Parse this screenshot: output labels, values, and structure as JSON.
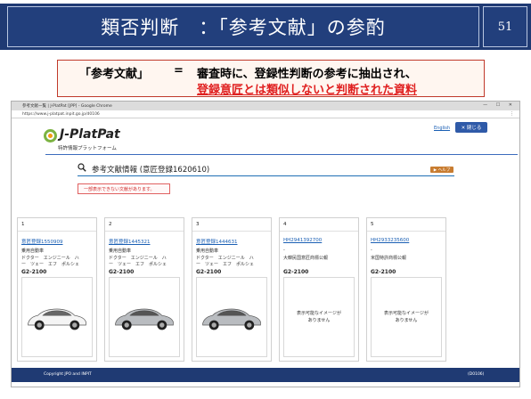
{
  "slide": {
    "title": "類否判断　：「参考文献」の参酌",
    "page_number": "51"
  },
  "definition": {
    "term": "「参考文献」",
    "equals": "=",
    "line1": "審査時に、登録性判断の参考に抽出され、",
    "line2": "登録意匠とは類似しないと判断された資料"
  },
  "browser": {
    "window_title": "参考文献一覧 | J-PlatPat [JPP] - Google Chrome",
    "url": "https://www.j-platpat.inpit.go.jp/d0106",
    "window_controls": "— ☐ ✕",
    "menu_icon": "⋮"
  },
  "site": {
    "logo_text": "J-PlatPat",
    "logo_subtitle": "特許情報プラットフォーム",
    "english_link": "English",
    "close_button": "✕ 閉じる",
    "section_title": "参考文献情報 (意匠登録1620610)",
    "help_button": "▶ ヘルプ",
    "warning": "一部表示できない文献があります。",
    "footer_copyright": "Copyright JPO and INPIT",
    "footer_code": "(D0106)"
  },
  "cards": [
    {
      "num": "1",
      "link": "意匠登録1550909",
      "line_a": "乗用自動車",
      "line_b": "ドクター　エンジニール　ハ",
      "line_c": "ー　ツェー　エフ　ポルシェ",
      "code": "G2-2100",
      "image": "car-white",
      "no_image_text": ""
    },
    {
      "num": "2",
      "link": "意匠登録1445321",
      "line_a": "乗用自動車",
      "line_b": "ドクター　エンジニール　ハ",
      "line_c": "ー　ツェー　エフ　ポルシェ",
      "code": "G2-2100",
      "image": "car-silver",
      "no_image_text": ""
    },
    {
      "num": "3",
      "link": "意匠登録1444631",
      "line_a": "乗用自動車",
      "line_b": "ドクター　エンジニール　ハ",
      "line_c": "ー　ツェー　エフ　ポルシェ",
      "code": "G2-2100",
      "image": "car-silver",
      "no_image_text": ""
    },
    {
      "num": "4",
      "link": "HH2941392700",
      "line_a": "-",
      "line_b": "大韓民国意匠商標公報",
      "line_c": "",
      "code": "G2-2100",
      "image": "none",
      "no_image_text": "表示可能なイメージが\nありません"
    },
    {
      "num": "5",
      "link": "HH2933235600",
      "line_a": "-",
      "line_b": "米国特許商標公報",
      "line_c": "",
      "code": "G2-2100",
      "image": "none",
      "no_image_text": "表示可能なイメージが\nありません"
    }
  ],
  "colors": {
    "title_band": "#1f3a73",
    "definition_border": "#c0392b",
    "highlight_red": "#e02020",
    "link_blue": "#1a5fb4",
    "footer": "#1f3a73"
  }
}
